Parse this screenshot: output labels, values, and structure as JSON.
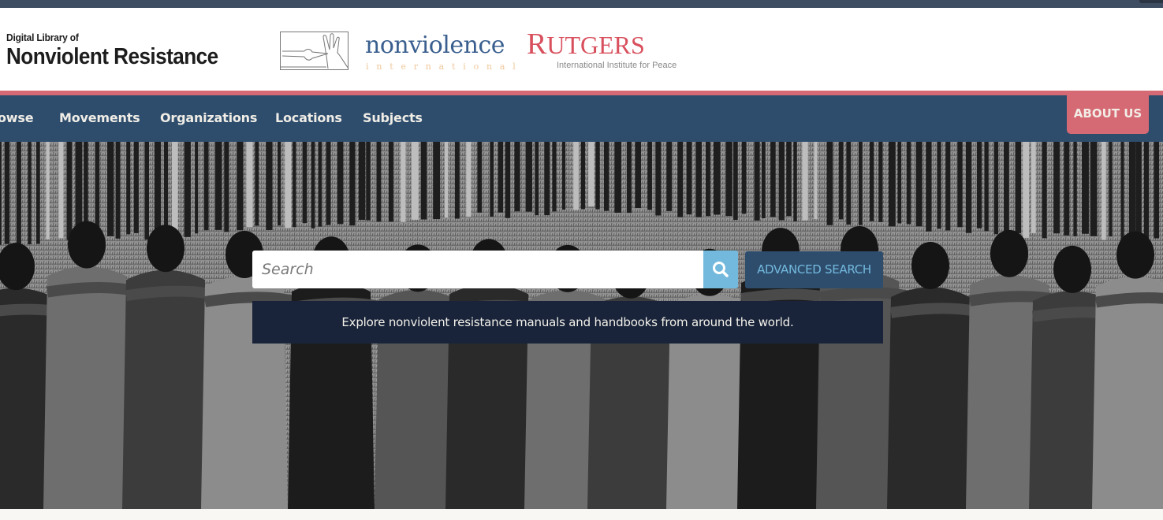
{
  "brand": {
    "site_title_small": "Digital Library of",
    "site_title_big": "Nonviolent Resistance",
    "partner_1": {
      "name": "nonviolence",
      "subtitle": "international",
      "primary_color": "#3a5f8f",
      "subtitle_color": "#f0c79a"
    },
    "partner_2": {
      "name_cap": "R",
      "name_rest": "UTGERS",
      "subtitle": "International Institute for Peace",
      "color": "#d8505d"
    }
  },
  "nav": {
    "items": [
      {
        "label": "owse"
      },
      {
        "label": "Movements"
      },
      {
        "label": "Organizations"
      },
      {
        "label": "Locations"
      },
      {
        "label": "Subjects"
      }
    ],
    "about_label": "ABOUT US"
  },
  "search": {
    "placeholder": "Search",
    "value": "",
    "search_icon": "magnifier-icon",
    "advanced_label": "ADVANCED SEARCH"
  },
  "tagline": "Explore nonviolent resistance manuals and handbooks from around the world.",
  "colors": {
    "nav_bg": "#2e4d6d",
    "accent_pink": "#d56a74",
    "search_button": "#73b9dd",
    "tagline_bg": "#19243a"
  },
  "hero_image": "black-and-white photo of people standing in a circle with arms around each other"
}
